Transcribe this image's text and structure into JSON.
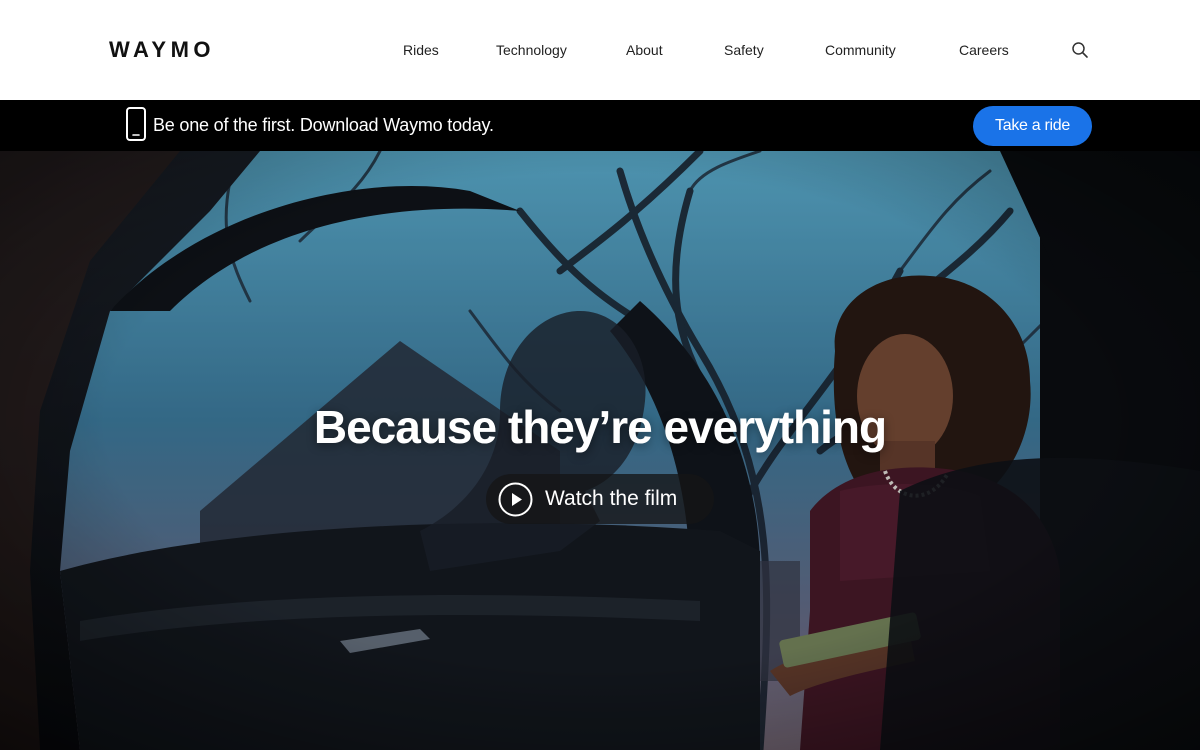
{
  "header": {
    "logo": "WAYMO",
    "nav": [
      {
        "label": "Rides"
      },
      {
        "label": "Technology"
      },
      {
        "label": "About"
      },
      {
        "label": "Safety"
      },
      {
        "label": "Community"
      },
      {
        "label": "Careers"
      }
    ],
    "search_icon": "search-icon"
  },
  "promo": {
    "icon": "phone-icon",
    "text": "Be one of the first. Download Waymo today.",
    "cta_label": "Take a ride"
  },
  "hero": {
    "title": "Because they’re everything",
    "watch_label": "Watch the film",
    "play_icon": "play-circle-icon"
  },
  "colors": {
    "header_bg": "#ffffff",
    "promo_bg": "#000000",
    "cta_bg": "#1a73e8",
    "text_dark": "#222222",
    "text_light": "#ffffff",
    "sky": "#4aa3c6"
  }
}
